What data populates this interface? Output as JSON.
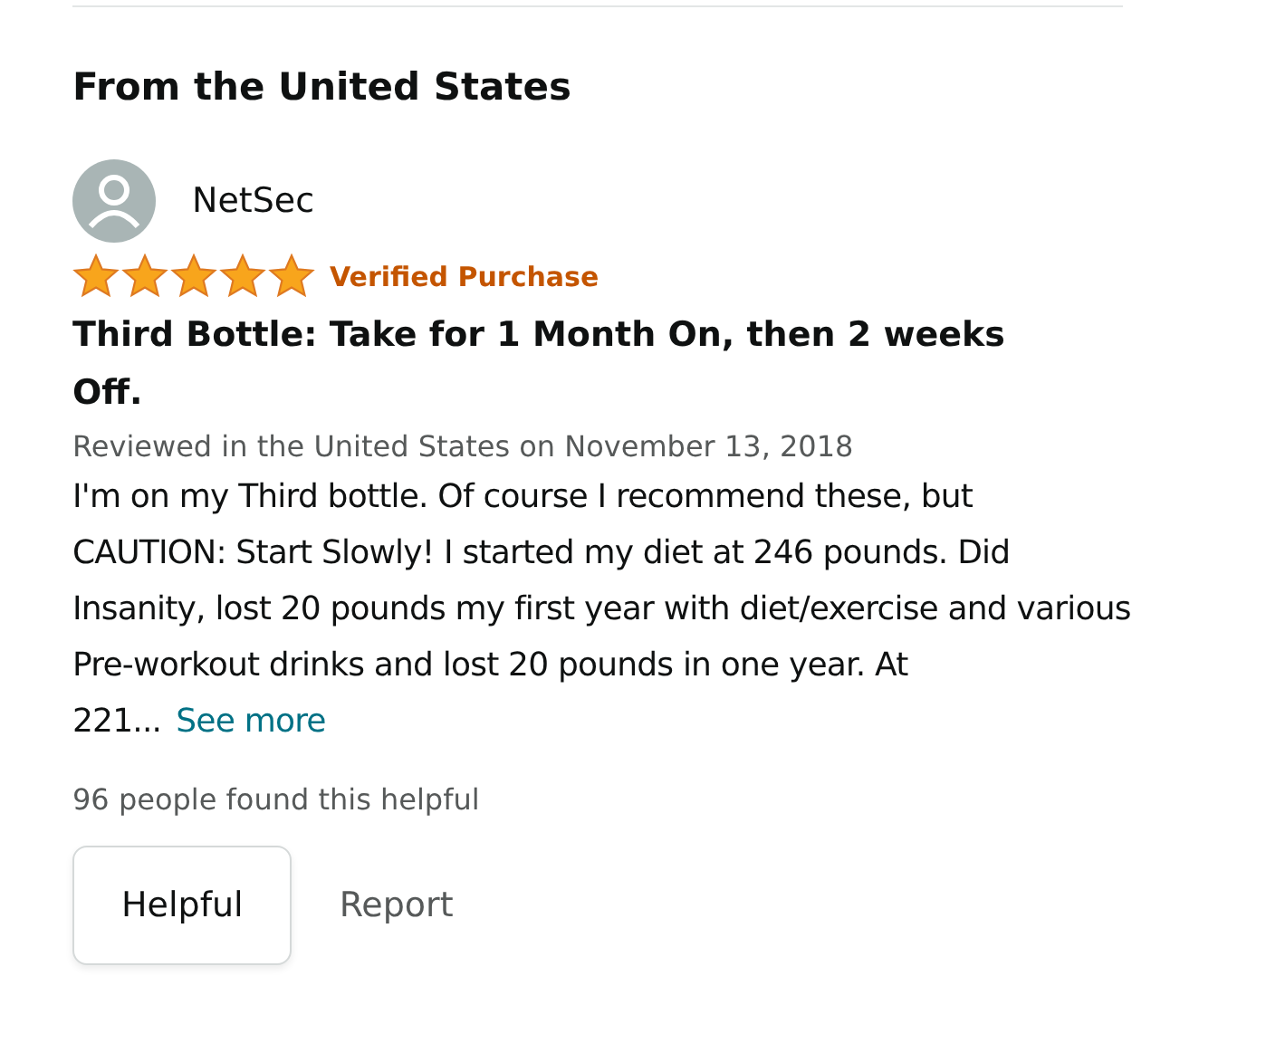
{
  "section_title": "From the United States",
  "review": {
    "author": "NetSec",
    "stars": 5,
    "badge": "Verified Purchase",
    "title": "Third Bottle: Take for 1 Month On, then 2 weeks Off.",
    "meta": "Reviewed in the United States on November 13, 2018",
    "body": "I'm on my Third bottle. Of course I recommend these, but CAUTION: Start Slowly! I started my diet at 246 pounds. Did Insanity, lost 20 pounds my first year with diet/exercise and various Pre-workout drinks and lost 20 pounds in one year. At 221...",
    "see_more": "See more",
    "helpful_count": "96 people found this helpful",
    "buttons": {
      "helpful": "Helpful",
      "report": "Report"
    }
  }
}
